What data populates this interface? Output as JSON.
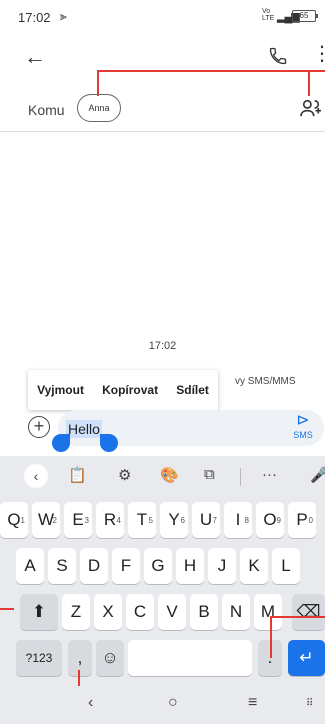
{
  "status": {
    "time": "17:02",
    "flag_icon": "play-flag",
    "net_top": "Vo",
    "net_bottom": "LTE",
    "signal": "4G",
    "battery": "65"
  },
  "appbar": {
    "back_icon": "arrow-left",
    "call_icon": "phone",
    "menu_icon": "more-vert"
  },
  "recipient": {
    "label": "Komu",
    "chip": "Anna",
    "add_icon": "add-person"
  },
  "conversation": {
    "timestamp": "17:02",
    "sms_note": "vy SMS/MMS"
  },
  "context_menu": {
    "items": [
      "Vyjmout",
      "Kopírovat",
      "Sdílet"
    ]
  },
  "composer": {
    "text": "Hello",
    "send_label": "SMS"
  },
  "keyboard": {
    "toolbar_icons": [
      "chevron-left",
      "clipboard",
      "gear",
      "palette",
      "screen",
      "more",
      "mic"
    ],
    "more": "···",
    "row1": [
      {
        "k": "Q",
        "h": "1"
      },
      {
        "k": "W",
        "h": "2"
      },
      {
        "k": "E",
        "h": "3"
      },
      {
        "k": "R",
        "h": "4"
      },
      {
        "k": "T",
        "h": "5"
      },
      {
        "k": "Y",
        "h": "6"
      },
      {
        "k": "U",
        "h": "7"
      },
      {
        "k": "I",
        "h": "8"
      },
      {
        "k": "O",
        "h": "9"
      },
      {
        "k": "P",
        "h": "0"
      }
    ],
    "row2": [
      "A",
      "S",
      "D",
      "F",
      "G",
      "H",
      "J",
      "K",
      "L"
    ],
    "row3": [
      "Z",
      "X",
      "C",
      "V",
      "B",
      "N",
      "M"
    ],
    "symbols": "?123",
    "comma": ",",
    "period": ".",
    "emoji_icon": "smiley"
  },
  "colors": {
    "accent": "#1a73e8",
    "callout": "#e53935"
  }
}
